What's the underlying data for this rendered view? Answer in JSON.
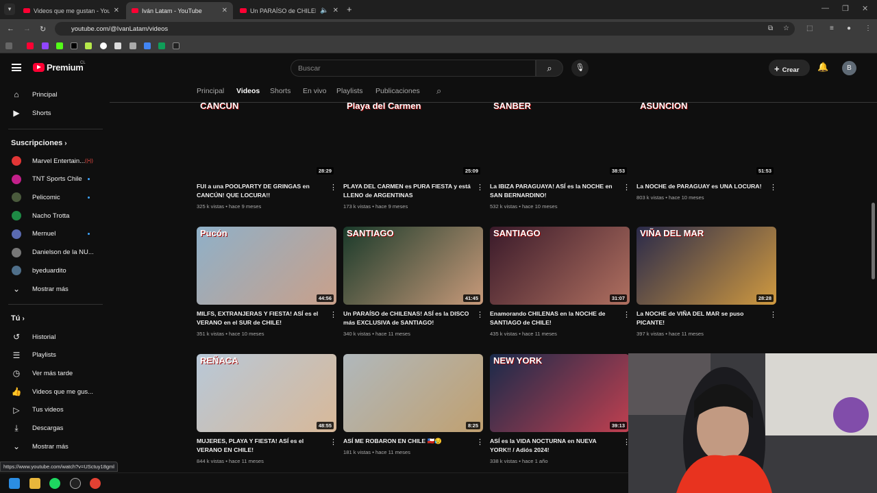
{
  "browser": {
    "tabs": [
      {
        "title": "Videos que me gustan - YouTube",
        "active": false
      },
      {
        "title": "Iván Latam - YouTube",
        "active": true
      },
      {
        "title": "Un PARAÍSO de CHILENAS",
        "active": false
      }
    ],
    "url": "youtube.com/@IvanLatam/videos"
  },
  "header": {
    "logo_text": "Premium",
    "logo_region": "CL",
    "search_placeholder": "Buscar",
    "create_label": "Crear",
    "avatar_letter": "B"
  },
  "sidebar": {
    "main": [
      {
        "label": "Principal",
        "icon": "home-icon"
      },
      {
        "label": "Shorts",
        "icon": "shorts-icon"
      }
    ],
    "subs_heading": "Suscripciones",
    "subs": [
      {
        "label": "Marvel Entertain...",
        "color": "#e23636",
        "badge": "live"
      },
      {
        "label": "TNT Sports Chile",
        "color": "#c3208a",
        "badge": "dot"
      },
      {
        "label": "Pelicomic",
        "color": "#4a5a3c",
        "badge": "dot"
      },
      {
        "label": "Nacho Trotta",
        "color": "#1e8a45",
        "badge": ""
      },
      {
        "label": "Mernuel",
        "color": "#5a6ab0",
        "badge": "dot"
      },
      {
        "label": "Danielson de la NU...",
        "color": "#777777",
        "badge": ""
      },
      {
        "label": "byeduardito",
        "color": "#4f6f8a",
        "badge": ""
      }
    ],
    "subs_more": "Mostrar más",
    "you_heading": "Tú",
    "you": [
      {
        "label": "Historial",
        "icon": "history-icon"
      },
      {
        "label": "Playlists",
        "icon": "playlists-icon"
      },
      {
        "label": "Ver más tarde",
        "icon": "clock-icon"
      },
      {
        "label": "Videos que me gus...",
        "icon": "thumbs-up-icon"
      },
      {
        "label": "Tus videos",
        "icon": "play-box-icon"
      },
      {
        "label": "Descargas",
        "icon": "download-icon"
      }
    ],
    "you_more": "Mostrar más"
  },
  "channel_tabs": [
    "Principal",
    "Videos",
    "Shorts",
    "En vivo",
    "Playlists",
    "Publicaciones"
  ],
  "selected_tab": "Videos",
  "videos": [
    {
      "thumb_text": "CANCUN",
      "duration": "28:29",
      "title": "FUI a una POOLPARTY DE GRINGAS en CANCÚN! QUE LOCURA!!",
      "views": "325 k vistas",
      "age": "hace 9 meses",
      "colors": [
        "#e05a7a",
        "#3aa5b8"
      ]
    },
    {
      "thumb_text": "Playa del Carmen",
      "duration": "25:09",
      "title": "PLAYA DEL CARMEN es PURA FIESTA y está LLENO de ARGENTINAS",
      "views": "173 k vistas",
      "age": "hace 9 meses",
      "colors": [
        "#49a6d8",
        "#d8b08a"
      ]
    },
    {
      "thumb_text": "SANBER",
      "duration": "38:53",
      "title": "La IBIZA PARAGUAYA! ASÍ es la NOCHE en SAN BERNARDINO!",
      "views": "532 k vistas",
      "age": "hace 10 meses",
      "colors": [
        "#2b3f7a",
        "#d88a6a"
      ]
    },
    {
      "thumb_text": "ASUNCION",
      "duration": "51:53",
      "title": "La NOCHE de PARAGUAY es UNA LOCURA!",
      "views": "803 k vistas",
      "age": "hace 10 meses",
      "colors": [
        "#1f6fa8",
        "#d07a48"
      ]
    },
    {
      "thumb_text": "Pucón",
      "duration": "44:56",
      "title": "MILFS, EXTRANJERAS Y FIESTA! ASÍ es el VERANO en el SUR de CHILE!",
      "views": "351 k vistas",
      "age": "hace 10 meses",
      "colors": [
        "#8fb0c8",
        "#c9a08a"
      ]
    },
    {
      "thumb_text": "SANTIAGO",
      "duration": "41:45",
      "title": "Un PARAÍSO de CHILENAS! ASÍ es la DISCO más EXCLUSIVA de SANTIAGO!",
      "views": "340 k vistas",
      "age": "hace 11 meses",
      "colors": [
        "#1a3a2a",
        "#c89a7a"
      ]
    },
    {
      "thumb_text": "SANTIAGO",
      "duration": "31:07",
      "title": "Enamorando CHILENAS en la NOCHE de SANTIAGO de CHILE!",
      "views": "435 k vistas",
      "age": "hace 11 meses",
      "colors": [
        "#3a1a2a",
        "#b07060"
      ]
    },
    {
      "thumb_text": "VIÑA DEL MAR",
      "duration": "28:28",
      "title": "La NOCHE de VIÑA DEL MAR se puso PICANTE!",
      "views": "397 k vistas",
      "age": "hace 11 meses",
      "colors": [
        "#2a2a4a",
        "#d09a40"
      ]
    },
    {
      "thumb_text": "REÑACA",
      "duration": "48:55",
      "title": "MUJERES, PLAYA Y FIESTA! ASÍ es el VERANO EN CHILE!",
      "views": "844 k vistas",
      "age": "hace 11 meses",
      "colors": [
        "#b8c8d8",
        "#d8b898"
      ]
    },
    {
      "thumb_text": "",
      "duration": "8:25",
      "title": "ASÍ ME ROBARON EN CHILE 🇨🇱😥",
      "views": "181 k vistas",
      "age": "hace 11 meses",
      "colors": [
        "#b0b8bc",
        "#c0a070"
      ]
    },
    {
      "thumb_text": "NEW YORK",
      "duration": "39:13",
      "title": "ASÍ es la VIDA NOCTURNA en NUEVA YORK!! / Adiós 2024!",
      "views": "338 k vistas",
      "age": "hace 1 año",
      "colors": [
        "#1a2a4a",
        "#c04050"
      ]
    }
  ],
  "status_url": "https://www.youtube.com/watch?v=USctuy18gml",
  "colors": {
    "accent": "#ff0033",
    "bg": "#0f0f0f",
    "link": "#3ea6ff"
  }
}
